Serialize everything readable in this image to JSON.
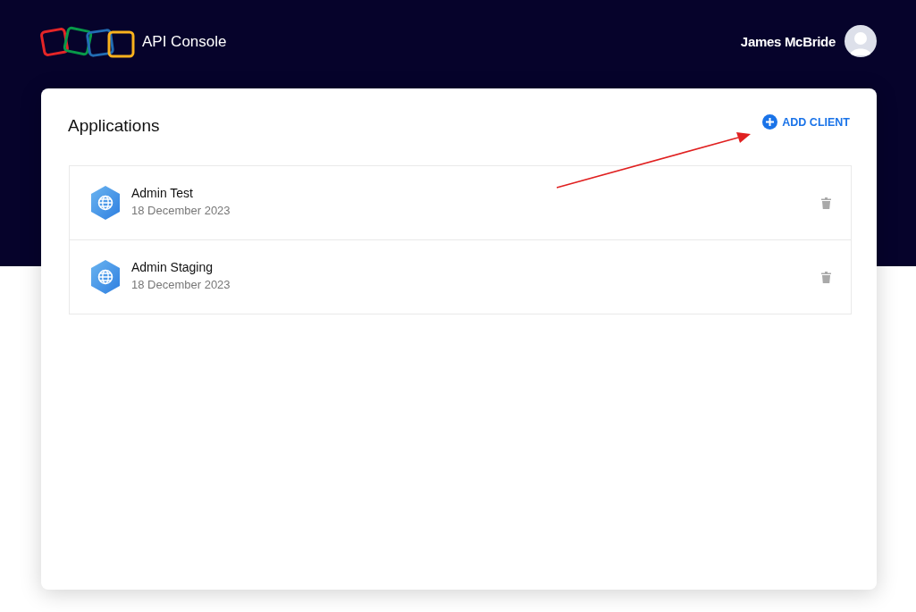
{
  "header": {
    "app_title": "API Console",
    "user_name": "James McBride"
  },
  "panel": {
    "title": "Applications",
    "add_button": "ADD CLIENT"
  },
  "applications": [
    {
      "name": "Admin Test",
      "date": "18 December 2023"
    },
    {
      "name": "Admin Staging",
      "date": "18 December 2023"
    }
  ]
}
